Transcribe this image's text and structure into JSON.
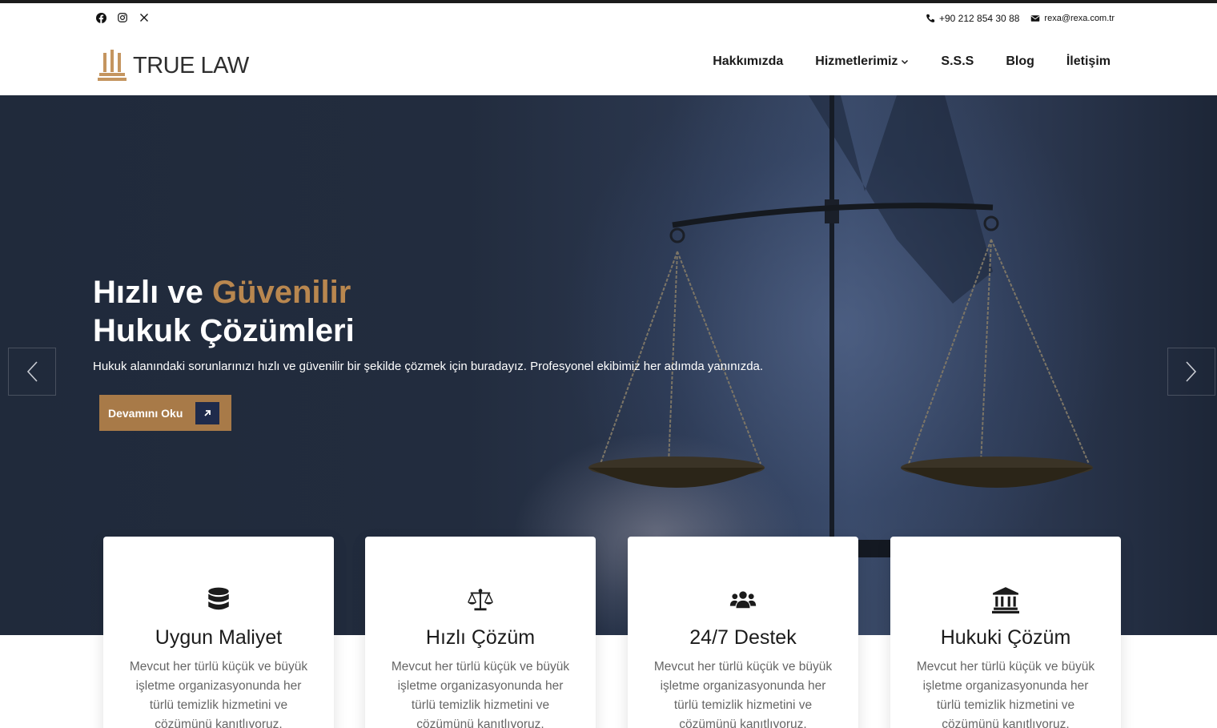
{
  "topbar": {
    "social": [
      {
        "icon": "facebook-icon"
      },
      {
        "icon": "instagram-icon"
      },
      {
        "icon": "x-twitter-icon"
      }
    ],
    "phone": "+90 212 854 30 88",
    "email": "rexa@rexa.com.tr"
  },
  "header": {
    "logo_text": "TRUE LAW",
    "nav": {
      "about": "Hakkımızda",
      "services": "Hizmetlerimiz",
      "faq": "S.S.S",
      "blog": "Blog",
      "contact": "İletişim"
    }
  },
  "hero": {
    "title_part1": "Hızlı ve ",
    "title_accent": "Güvenilir",
    "title_line2": "Hukuk Çözümleri",
    "subtitle": "Hukuk alanındaki sorunlarınızı hızlı ve güvenilir bir şekilde çözmek için buradayız. Profesyonel ekibimiz her adımda yanınızda.",
    "button_label": "Devamını Oku"
  },
  "features": [
    {
      "icon": "database-icon",
      "title": "Uygun Maliyet",
      "text": "Mevcut her türlü küçük ve büyük işletme organizasyonunda her türlü temizlik hizmetini ve çözümünü kanıtlıyoruz."
    },
    {
      "icon": "scale-icon",
      "title": "Hızlı Çözüm",
      "text": "Mevcut her türlü küçük ve büyük işletme organizasyonunda her türlü temizlik hizmetini ve çözümünü kanıtlıyoruz."
    },
    {
      "icon": "users-icon",
      "title": "24/7 Destek",
      "text": "Mevcut her türlü küçük ve büyük işletme organizasyonunda her türlü temizlik hizmetini ve çözümünü kanıtlıyoruz."
    },
    {
      "icon": "bank-icon",
      "title": "Hukuki Çözüm",
      "text": "Mevcut her türlü küçük ve büyük işletme organizasyonunda her türlü temizlik hizmetini ve çözümünü kanıtlıyoruz."
    }
  ],
  "colors": {
    "accent": "#b9874f",
    "button": "#a87a48",
    "navy": "#1f2b4b",
    "hero_bg": "#222c3e"
  }
}
